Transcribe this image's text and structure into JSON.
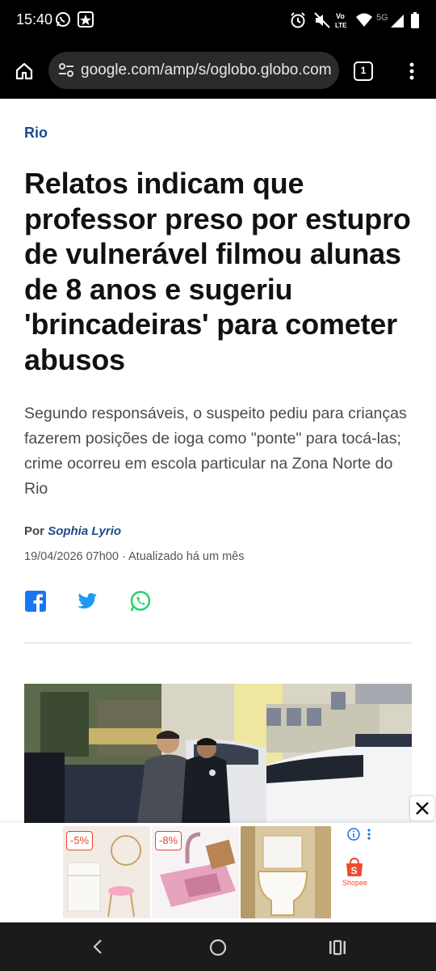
{
  "status_bar": {
    "time": "15:40",
    "network_label": "5G",
    "volte_label": "Vo LTE"
  },
  "browser": {
    "url": "google.com/amp/s/oglobo.globo.com",
    "tab_count": "1"
  },
  "article": {
    "section": "Rio",
    "headline": "Relatos indicam que professor preso por estupro de vulnerável filmou alunas de 8 anos e sugeriu 'brincadeiras' para cometer abusos",
    "subtitle": "Segundo responsáveis, o suspeito pediu para crianças fazerem posições de ioga como \"ponte\" para tocá-las; crime ocorreu em escola particular na Zona Norte do Rio",
    "byline_prefix": "Por",
    "author": "Sophia Lyrio",
    "date": "19/04/2026 07h00 · Atualizado há um mês"
  },
  "share": [
    "facebook-icon",
    "twitter-icon",
    "whatsapp-icon"
  ],
  "ad": {
    "items": [
      {
        "badge": "-5%",
        "name": "vanity-dresser"
      },
      {
        "badge": "-8%",
        "name": "kitchen-sink"
      },
      {
        "badge": "",
        "name": "toilet"
      }
    ],
    "brand": "Shopee"
  },
  "colors": {
    "accent": "#1a4b8c",
    "facebook": "#1877f2",
    "twitter": "#1d9bf0",
    "whatsapp": "#25d366",
    "shopee": "#ee4d2d"
  }
}
